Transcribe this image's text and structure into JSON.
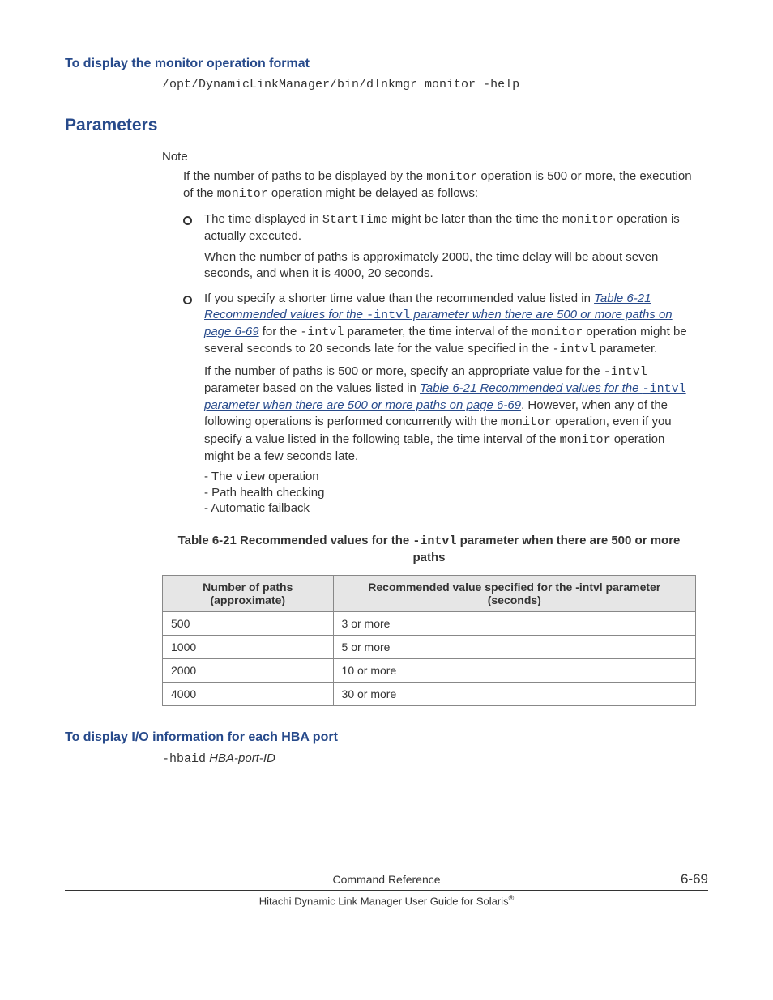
{
  "section1": {
    "heading": "To display the monitor operation format",
    "code": "/opt/DynamicLinkManager/bin/dlnkmgr monitor -help"
  },
  "section2": {
    "heading": "Parameters",
    "note_label": "Note",
    "note_intro_1": "If the number of paths to be displayed by the ",
    "note_intro_code1": "monitor",
    "note_intro_2": " operation is 500 or more, the execution of the ",
    "note_intro_code2": "monitor",
    "note_intro_3": " operation might be delayed as follows:",
    "bullets": [
      {
        "p1_a": "The time displayed in ",
        "p1_code": "StartTime",
        "p1_b": " might be later than the time the ",
        "p1_code2": "monitor",
        "p1_c": " operation is actually executed.",
        "p2": "When the number of paths is approximately 2000, the time delay will be about seven seconds, and when it is 4000, 20 seconds."
      },
      {
        "p1_a": "If you specify a shorter time value than the recommended value listed in ",
        "link1_a": "Table 6-21 Recommended values for the ",
        "link1_code": "-intvl",
        "link1_b": " parameter when there are 500 or more paths on page 6-69",
        "p1_b": " for the ",
        "p1_code": "-intvl",
        "p1_c": " parameter, the time interval of the ",
        "p1_code2": "monitor",
        "p1_d": " operation might be several seconds to 20 seconds late for the value specified in the ",
        "p1_code3": "-intvl",
        "p1_e": " parameter.",
        "p2_a": "If the number of paths is 500 or more, specify an appropriate value for the ",
        "p2_code": "-intvl",
        "p2_b": " parameter based on the values listed in ",
        "link2_a": "Table 6-21 Recommended values for the ",
        "link2_code": "-intvl",
        "link2_b": " parameter when there are 500 or more paths on page 6-69",
        "p2_c": ". However, when any of the following operations is performed concurrently with the ",
        "p2_code2": "monitor",
        "p2_d": " operation, even if you specify a value listed in the following table, the time interval of the ",
        "p2_code3": "monitor",
        "p2_e": " operation might be a few seconds late.",
        "sub1_a": "- The ",
        "sub1_code": "view",
        "sub1_b": " operation",
        "sub2": "- Path health checking",
        "sub3": "- Automatic failback"
      }
    ]
  },
  "table": {
    "caption_a": "Table 6-21 Recommended values for the ",
    "caption_code": "-intvl",
    "caption_b": " parameter when there are 500 or more paths",
    "headers": [
      "Number of paths (approximate)",
      "Recommended value specified for the -intvl parameter (seconds)"
    ],
    "rows": [
      [
        "500",
        "3 or more"
      ],
      [
        "1000",
        "5 or more"
      ],
      [
        "2000",
        "10 or more"
      ],
      [
        "4000",
        "30 or more"
      ]
    ]
  },
  "section3": {
    "heading": "To display I/O information for each HBA port",
    "code": "-hbaid",
    "ital": " HBA-port-ID"
  },
  "footer": {
    "center": "Command Reference",
    "right": "6-69",
    "line2_a": "Hitachi Dynamic Link Manager User Guide for Solaris",
    "line2_sup": "®"
  }
}
